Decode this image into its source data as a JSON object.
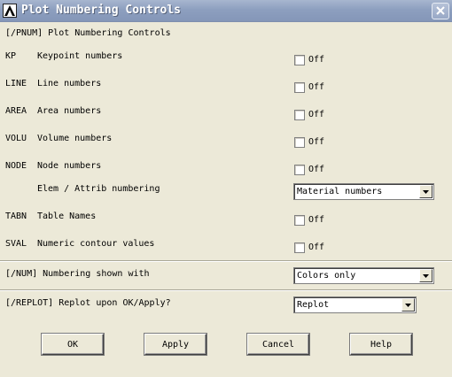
{
  "window": {
    "title": "Plot Numbering Controls",
    "close_label": "×"
  },
  "header": {
    "text": "[/PNUM]  Plot Numbering Controls"
  },
  "rows": [
    {
      "code": "KP",
      "label": "Keypoint numbers",
      "checkbox_text": "Off"
    },
    {
      "code": "LINE",
      "label": "Line numbers",
      "checkbox_text": "Off"
    },
    {
      "code": "AREA",
      "label": "Area numbers",
      "checkbox_text": "Off"
    },
    {
      "code": "VOLU",
      "label": "Volume numbers",
      "checkbox_text": "Off"
    },
    {
      "code": "NODE",
      "label": "Node numbers",
      "checkbox_text": "Off"
    }
  ],
  "elem": {
    "label": "Elem / Attrib numbering",
    "selected": "Material numbers"
  },
  "rows2": [
    {
      "code": "TABN",
      "label": "Table Names",
      "checkbox_text": "Off"
    },
    {
      "code": "SVAL",
      "label": "Numeric contour values",
      "checkbox_text": "Off"
    }
  ],
  "num": {
    "label": "[/NUM]  Numbering shown with",
    "selected": "Colors only"
  },
  "replot": {
    "label": "[/REPLOT] Replot upon OK/Apply?",
    "selected": "Replot"
  },
  "buttons": {
    "ok": "OK",
    "apply": "Apply",
    "cancel": "Cancel",
    "help": "Help"
  }
}
